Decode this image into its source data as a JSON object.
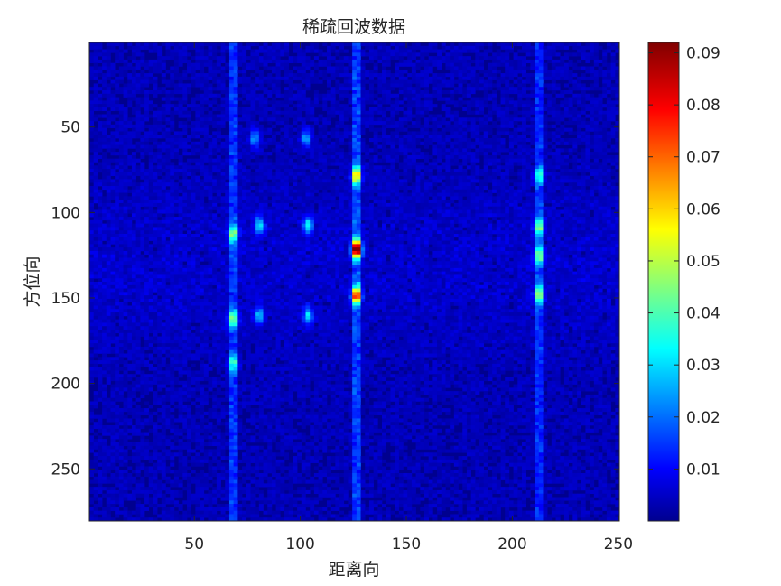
{
  "chart_data": {
    "type": "heatmap",
    "title": "稀疏回波数据",
    "xlabel": "距离向",
    "ylabel": "方位向",
    "x_range": [
      1,
      250
    ],
    "y_range": [
      1,
      280
    ],
    "y_direction": "reversed",
    "x_ticks": [
      50,
      100,
      150,
      200,
      250
    ],
    "y_ticks": [
      50,
      100,
      150,
      200,
      250
    ],
    "x_tick_labels": [
      "50",
      "100",
      "150",
      "200",
      "250"
    ],
    "y_tick_labels": [
      "50",
      "100",
      "150",
      "200",
      "250"
    ],
    "colormap": "jet",
    "color_range": [
      0,
      0.092
    ],
    "colorbar_ticks": [
      0.01,
      0.02,
      0.03,
      0.04,
      0.05,
      0.06,
      0.07,
      0.08,
      0.09
    ],
    "colorbar_tick_labels": [
      "0.01",
      "0.02",
      "0.03",
      "0.04",
      "0.05",
      "0.06",
      "0.07",
      "0.08",
      "0.09"
    ],
    "background_level": 0.005,
    "vertical_streaks": [
      {
        "x": 68,
        "level": 0.018
      },
      {
        "x": 126,
        "level": 0.02
      },
      {
        "x": 212,
        "level": 0.017
      }
    ],
    "hotspots": [
      {
        "x": 126,
        "y": 121,
        "value": 0.09
      },
      {
        "x": 126,
        "y": 148,
        "value": 0.065
      },
      {
        "x": 126,
        "y": 78,
        "value": 0.05
      },
      {
        "x": 212,
        "y": 108,
        "value": 0.035
      },
      {
        "x": 212,
        "y": 125,
        "value": 0.033
      },
      {
        "x": 212,
        "y": 148,
        "value": 0.038
      },
      {
        "x": 212,
        "y": 78,
        "value": 0.028
      },
      {
        "x": 68,
        "y": 112,
        "value": 0.035
      },
      {
        "x": 68,
        "y": 162,
        "value": 0.035
      },
      {
        "x": 68,
        "y": 188,
        "value": 0.028
      },
      {
        "x": 80,
        "y": 107,
        "value": 0.03
      },
      {
        "x": 103,
        "y": 107,
        "value": 0.03
      },
      {
        "x": 80,
        "y": 160,
        "value": 0.025
      },
      {
        "x": 103,
        "y": 160,
        "value": 0.025
      },
      {
        "x": 78,
        "y": 56,
        "value": 0.022
      },
      {
        "x": 102,
        "y": 56,
        "value": 0.022
      }
    ]
  }
}
